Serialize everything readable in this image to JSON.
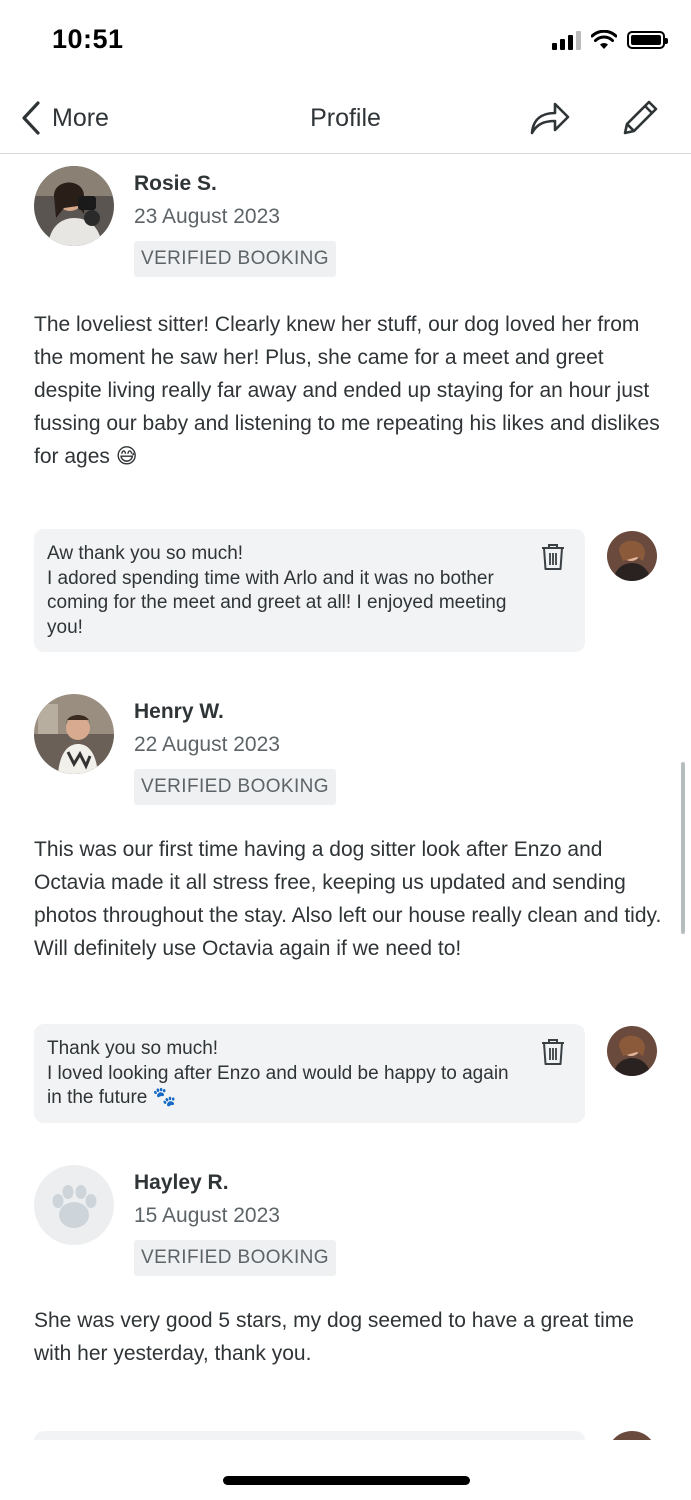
{
  "status_bar": {
    "time": "10:51"
  },
  "nav": {
    "back_label": "More",
    "title": "Profile"
  },
  "reviews": [
    {
      "name": "Rosie S.",
      "date": "23 August 2023",
      "badge": "VERIFIED BOOKING",
      "text": "The loveliest sitter! Clearly knew her stuff, our dog loved her from the moment he saw her! Plus, she came for a meet and greet despite living really far away and ended up staying for an hour just fussing our baby and listening to me repeating his likes and dislikes for ages 😅",
      "reply": "Aw thank you so much!\nI adored spending time with Arlo and it was no bother coming for the meet and greet at all! I enjoyed meeting you!"
    },
    {
      "name": "Henry W.",
      "date": "22 August 2023",
      "badge": "VERIFIED BOOKING",
      "text": "This was our first time having a dog sitter look after Enzo and Octavia made it all stress free, keeping us updated and sending photos throughout the stay. Also left our house really clean and tidy. Will definitely use Octavia again if we need to!",
      "reply": "Thank you so much!\nI loved looking after Enzo and would be happy to again in the future 🐾"
    },
    {
      "name": "Hayley R.",
      "date": "15 August 2023",
      "badge": "VERIFIED BOOKING",
      "text": "She was very good 5 stars, my dog seemed to have a great time with her yesterday, thank you."
    }
  ],
  "icons": {
    "back": "chevron-left-icon",
    "share": "share-arrow-icon",
    "edit": "pencil-icon",
    "delete": "trash-icon",
    "placeholder_avatar": "paw-icon"
  }
}
